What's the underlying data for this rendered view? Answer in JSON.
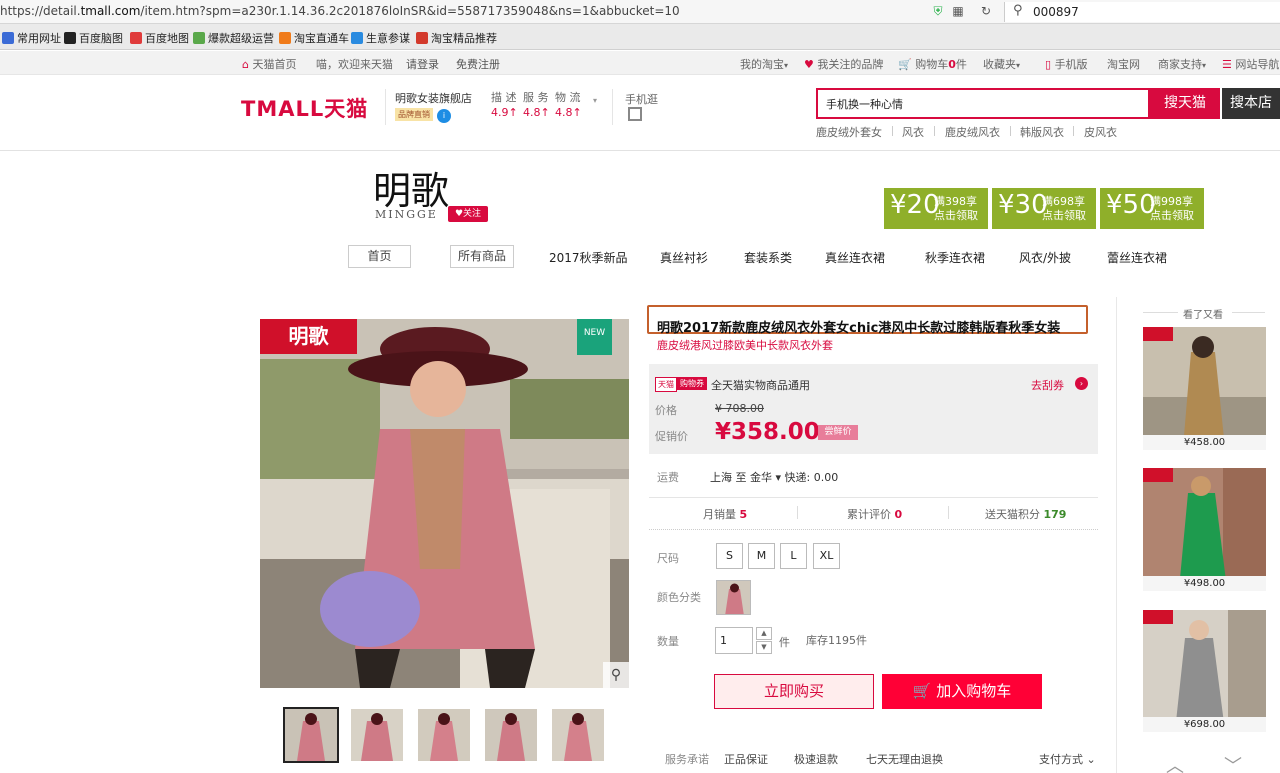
{
  "browser": {
    "url_prefix": "https://detail.",
    "url_domain": "tmall.com",
    "url_rest": "/item.htm?spm=a230r.1.14.36.2c201876loInSR&id=558717359048&ns=1&abbucket=10",
    "search_value": "000897"
  },
  "bookmarks": [
    {
      "label": "常用网址",
      "color": "#3b6bd6"
    },
    {
      "label": "百度脑图",
      "color": "#222222"
    },
    {
      "label": "百度地图",
      "color": "#e03b3b"
    },
    {
      "label": "爆款超级运营",
      "color": "#5aa84a"
    },
    {
      "label": "淘宝直通车",
      "color": "#f07b1a"
    },
    {
      "label": "生意参谋",
      "color": "#2a8be0"
    },
    {
      "label": "淘宝精品推荐",
      "color": "#d33a2c"
    }
  ],
  "topnav": {
    "home": "天猫首页",
    "welcome": "喵，欢迎来天猫",
    "login": "请登录",
    "register": "免费注册",
    "my_taobao": "我的淘宝",
    "brands": "我关注的品牌",
    "cart": "购物车",
    "cart_count": "0",
    "cart_unit": "件",
    "favorites": "收藏夹",
    "mobile": "手机版",
    "taobao": "淘宝网",
    "merchant": "商家支持",
    "sitenav": "网站导航"
  },
  "header": {
    "logo": "TMALL天猫",
    "shop_name": "明歌女装旗舰店",
    "shop_badge": "品牌直销",
    "score_labels": [
      "描 述",
      "服 务",
      "物 流"
    ],
    "scores": [
      "4.9",
      "4.8",
      "4.8"
    ],
    "mobile_label": "手机逛",
    "search_value": "手机换一种心情",
    "search_tmall": "搜天猫",
    "search_shop": "搜本店",
    "hot": [
      "鹿皮绒外套女",
      "风衣",
      "鹿皮绒风衣",
      "韩版风衣",
      "皮风衣"
    ]
  },
  "brand": {
    "cn": "明歌",
    "en": "MINGGE",
    "follow": "关注",
    "coupons": [
      {
        "amount": "¥20",
        "threshold": "满398享",
        "claim": "点击领取"
      },
      {
        "amount": "¥30",
        "threshold": "满698享",
        "claim": "点击领取"
      },
      {
        "amount": "¥50",
        "threshold": "满998享",
        "claim": "点击领取"
      }
    ]
  },
  "shopnav": {
    "home": "首页",
    "all": "所有商品",
    "items": [
      "2017秋季新品",
      "真丝衬衫",
      "套装系类",
      "真丝连衣裙",
      "秋季连衣裙",
      "风衣/外披",
      "蕾丝连衣裙"
    ]
  },
  "product": {
    "badge": "明歌",
    "new": "NEW",
    "title": "明歌2017新款鹿皮绒风衣外套女chic港风中长款过膝韩版春秋季女装",
    "subtitle": "鹿皮绒港风过膝欧美中长款风衣外套",
    "tag1": "天猫",
    "tag2": "购物券",
    "coupon_text": "全天猫实物商品通用",
    "coupon_link": "去刮券",
    "price_label": "价格",
    "orig_price": "¥ 708.00",
    "sale_label": "促销价",
    "sale_price": "¥358.00",
    "sale_tag": "尝鲜价",
    "ship_label": "运费",
    "ship_text": "上海 至 金华 ▾  快递: 0.00",
    "monthly_label": "月销量",
    "monthly": "5",
    "reviews_label": "累计评价",
    "reviews": "0",
    "points_label": "送天猫积分",
    "points": "179",
    "size_label": "尺码",
    "sizes": [
      "S",
      "M",
      "L",
      "XL"
    ],
    "color_label": "颜色分类",
    "qty_label": "数量",
    "qty": "1",
    "qty_unit": "件",
    "stock": "库存1195件",
    "buy_now": "立即购买",
    "add_cart": "加入购物车",
    "svc_label": "服务承诺",
    "svc": [
      "正品保证",
      "极速退款",
      "七天无理由退换"
    ],
    "pay": "支付方式"
  },
  "recommend": {
    "title": "看了又看",
    "items": [
      {
        "price": "¥458.00"
      },
      {
        "price": "¥498.00"
      },
      {
        "price": "¥698.00"
      }
    ]
  }
}
